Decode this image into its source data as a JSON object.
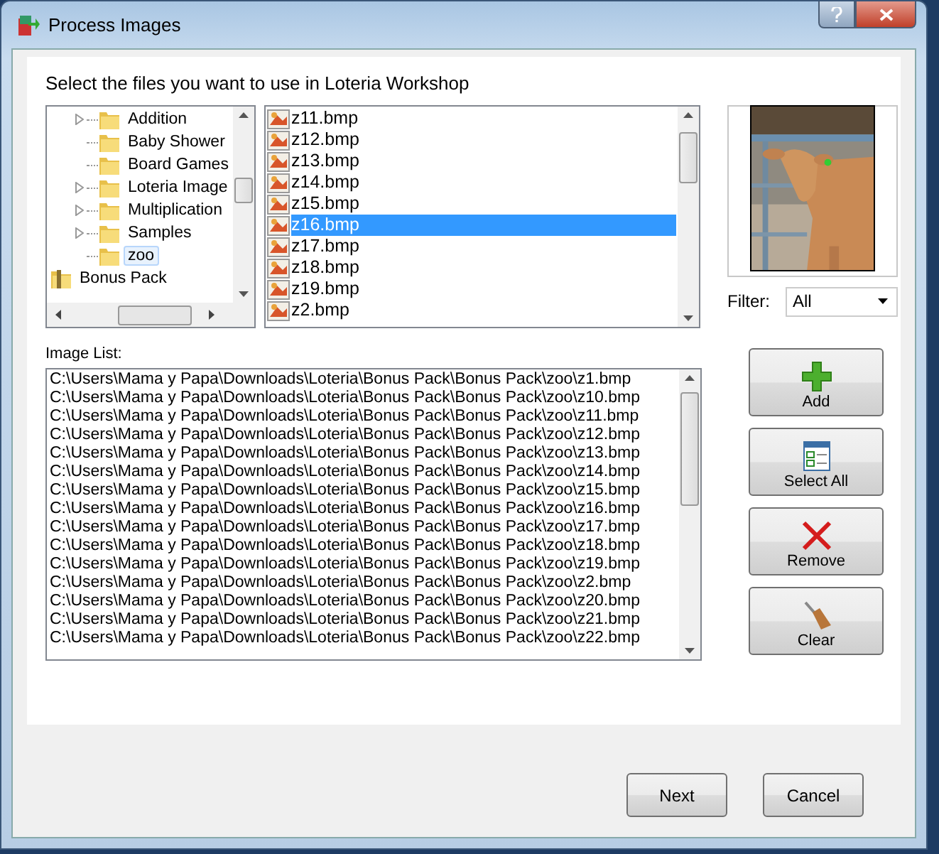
{
  "window": {
    "title": "Process Images"
  },
  "instruction": "Select the files you want to use in Loteria Workshop",
  "tree": {
    "items": [
      {
        "kind": "group",
        "children": [
          {
            "label": "Addition",
            "kind": "folder",
            "expandable": true,
            "selected": false
          },
          {
            "label": "Baby Shower",
            "kind": "folder",
            "expandable": false,
            "selected": false
          },
          {
            "label": "Board Games",
            "kind": "folder",
            "expandable": false,
            "selected": false
          },
          {
            "label": "Loteria Image",
            "kind": "folder",
            "expandable": true,
            "selected": false
          },
          {
            "label": "Multiplication",
            "kind": "folder",
            "expandable": true,
            "selected": false
          },
          {
            "label": "Samples",
            "kind": "folder",
            "expandable": true,
            "selected": false
          },
          {
            "label": "zoo",
            "kind": "folder",
            "expandable": false,
            "selected": true
          }
        ]
      },
      {
        "label": "Bonus Pack",
        "kind": "archive",
        "selected": false
      }
    ]
  },
  "files": [
    {
      "name": "z11.bmp",
      "selected": false
    },
    {
      "name": "z12.bmp",
      "selected": false
    },
    {
      "name": "z13.bmp",
      "selected": false
    },
    {
      "name": "z14.bmp",
      "selected": false
    },
    {
      "name": "z15.bmp",
      "selected": false
    },
    {
      "name": "z16.bmp",
      "selected": true
    },
    {
      "name": "z17.bmp",
      "selected": false
    },
    {
      "name": "z18.bmp",
      "selected": false
    },
    {
      "name": "z19.bmp",
      "selected": false
    },
    {
      "name": "z2.bmp",
      "selected": false
    }
  ],
  "filter": {
    "label": "Filter:",
    "value": "All"
  },
  "image_list": {
    "label": "Image List:",
    "items": [
      "C:\\Users\\Mama y Papa\\Downloads\\Loteria\\Bonus Pack\\Bonus Pack\\zoo\\z1.bmp",
      "C:\\Users\\Mama y Papa\\Downloads\\Loteria\\Bonus Pack\\Bonus Pack\\zoo\\z10.bmp",
      "C:\\Users\\Mama y Papa\\Downloads\\Loteria\\Bonus Pack\\Bonus Pack\\zoo\\z11.bmp",
      "C:\\Users\\Mama y Papa\\Downloads\\Loteria\\Bonus Pack\\Bonus Pack\\zoo\\z12.bmp",
      "C:\\Users\\Mama y Papa\\Downloads\\Loteria\\Bonus Pack\\Bonus Pack\\zoo\\z13.bmp",
      "C:\\Users\\Mama y Papa\\Downloads\\Loteria\\Bonus Pack\\Bonus Pack\\zoo\\z14.bmp",
      "C:\\Users\\Mama y Papa\\Downloads\\Loteria\\Bonus Pack\\Bonus Pack\\zoo\\z15.bmp",
      "C:\\Users\\Mama y Papa\\Downloads\\Loteria\\Bonus Pack\\Bonus Pack\\zoo\\z16.bmp",
      "C:\\Users\\Mama y Papa\\Downloads\\Loteria\\Bonus Pack\\Bonus Pack\\zoo\\z17.bmp",
      "C:\\Users\\Mama y Papa\\Downloads\\Loteria\\Bonus Pack\\Bonus Pack\\zoo\\z18.bmp",
      "C:\\Users\\Mama y Papa\\Downloads\\Loteria\\Bonus Pack\\Bonus Pack\\zoo\\z19.bmp",
      "C:\\Users\\Mama y Papa\\Downloads\\Loteria\\Bonus Pack\\Bonus Pack\\zoo\\z2.bmp",
      "C:\\Users\\Mama y Papa\\Downloads\\Loteria\\Bonus Pack\\Bonus Pack\\zoo\\z20.bmp",
      "C:\\Users\\Mama y Papa\\Downloads\\Loteria\\Bonus Pack\\Bonus Pack\\zoo\\z21.bmp",
      "C:\\Users\\Mama y Papa\\Downloads\\Loteria\\Bonus Pack\\Bonus Pack\\zoo\\z22.bmp"
    ]
  },
  "actions": [
    {
      "label": "Add",
      "kind": "add"
    },
    {
      "label": "Select All",
      "kind": "select_all"
    },
    {
      "label": "Remove",
      "kind": "remove"
    },
    {
      "label": "Clear",
      "kind": "clear"
    }
  ],
  "buttons": [
    "Next",
    "Cancel"
  ]
}
